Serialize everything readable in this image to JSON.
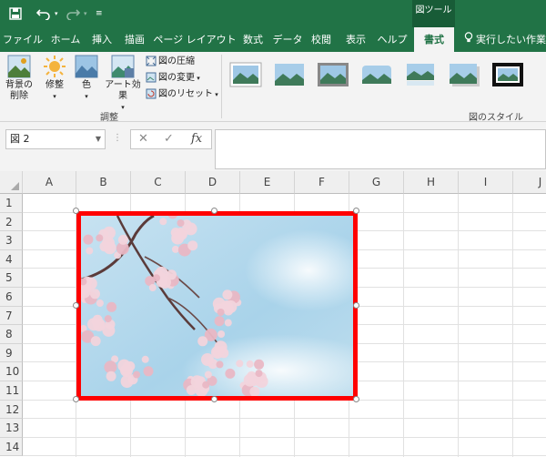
{
  "quick_access": {
    "save_icon": "save-icon",
    "undo_icon": "undo-icon",
    "redo_icon": "redo-icon",
    "customize_icon": "customize-qat-icon"
  },
  "context_tab_label": "図ツール",
  "tabs": [
    "ファイル",
    "ホーム",
    "挿入",
    "描画",
    "ページ レイアウト",
    "数式",
    "データ",
    "校閲",
    "表示",
    "ヘルプ",
    "書式"
  ],
  "active_tab": "書式",
  "tell_me": "実行したい作業を入",
  "ribbon": {
    "remove_bg": "背景の\n削除",
    "corrections": "修整",
    "color": "色",
    "artistic": "アート効果",
    "compress": "図の圧縮",
    "change": "図の変更",
    "reset": "図のリセット",
    "adjust_group": "調整",
    "styles_group": "図のスタイル"
  },
  "name_box": "図 2",
  "fx_label": "fx",
  "columns": [
    "A",
    "B",
    "C",
    "D",
    "E",
    "F",
    "G",
    "H",
    "I",
    "J"
  ],
  "rows": [
    "1",
    "2",
    "3",
    "4",
    "5",
    "6",
    "7",
    "8",
    "9",
    "10",
    "11",
    "12",
    "13",
    "14"
  ],
  "picture": {
    "border_color": "#ff0000",
    "sky_color": "#a9d3ea",
    "blossom_color": "#f2d4dc",
    "subject": "cherry-blossom-photo"
  },
  "colors": {
    "brand": "#217346",
    "context_tab": "#185c37"
  }
}
